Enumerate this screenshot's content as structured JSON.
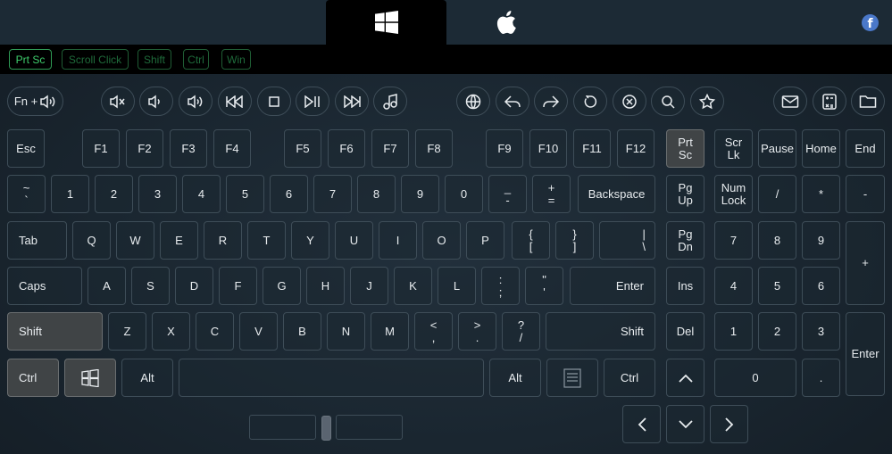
{
  "modifiers": [
    {
      "label": "Prt Sc",
      "active": true
    },
    {
      "label": "Scroll Click",
      "active": false
    },
    {
      "label": "Shift",
      "active": false
    },
    {
      "label": "Ctrl",
      "active": false
    },
    {
      "label": "Win",
      "active": false
    }
  ],
  "os_tabs": {
    "active": "windows",
    "icons": [
      "windows-logo-icon",
      "apple-logo-icon"
    ]
  },
  "header": {
    "social_icon": "facebook-icon",
    "fb_glyph": "f"
  },
  "media_keys": {
    "fn_vol": "Fn +"
  },
  "row_f": {
    "esc": "Esc",
    "f1": "F1",
    "f2": "F2",
    "f3": "F3",
    "f4": "F4",
    "f5": "F5",
    "f6": "F6",
    "f7": "F7",
    "f8": "F8",
    "f9": "F9",
    "f10": "F10",
    "f11": "F11",
    "f12": "F12",
    "prtsc": [
      "Prt",
      "Sc"
    ],
    "scrlk": [
      "Scr",
      "Lk"
    ],
    "pause": "Pause",
    "home": "Home",
    "end": "End"
  },
  "row_num": {
    "tilde": [
      "~",
      "`"
    ],
    "d1": "1",
    "d2": "2",
    "d3": "3",
    "d4": "4",
    "d5": "5",
    "d6": "6",
    "d7": "7",
    "d8": "8",
    "d9": "9",
    "d0": "0",
    "minus": [
      "_",
      "-"
    ],
    "equal": [
      "+",
      "="
    ],
    "backspace": "Backspace",
    "pgup": [
      "Pg",
      "Up"
    ],
    "numlock": [
      "Num",
      "Lock"
    ],
    "slash": "/",
    "star": "*",
    "dash": "-"
  },
  "row_q": {
    "tab": "Tab",
    "q": "Q",
    "w": "W",
    "e": "E",
    "r": "R",
    "t": "T",
    "y": "Y",
    "u": "U",
    "i": "I",
    "o": "O",
    "p": "P",
    "lbr": [
      "{",
      "["
    ],
    "rbr": [
      "}",
      "]"
    ],
    "pipe": [
      "|",
      "\\"
    ],
    "pgdn": [
      "Pg",
      "Dn"
    ],
    "n7": "7",
    "n8": "8",
    "n9": "9",
    "plus": "+"
  },
  "row_a": {
    "caps": "Caps",
    "a": "A",
    "s": "S",
    "d": "D",
    "f": "F",
    "g": "G",
    "h": "H",
    "j": "J",
    "k": "K",
    "l": "L",
    "semi": [
      ":",
      ";"
    ],
    "quote": [
      "\"",
      "'"
    ],
    "enter": "Enter",
    "ins": "Ins",
    "n4": "4",
    "n5": "5",
    "n6": "6"
  },
  "row_z": {
    "shift": "Shift",
    "z": "Z",
    "x": "X",
    "c": "C",
    "v": "V",
    "b": "B",
    "n": "N",
    "m": "M",
    "comma": [
      "<",
      ","
    ],
    "period": [
      ">",
      "."
    ],
    "question": [
      "?",
      "/"
    ],
    "rshift": "Shift",
    "del": "Del",
    "n1": "1",
    "n2": "2",
    "n3": "3",
    "numenter": "Enter"
  },
  "row_ctrl": {
    "ctrl": "Ctrl",
    "alt": "Alt",
    "ralt": "Alt",
    "rctrl": "Ctrl",
    "n0": "0",
    "ndot": "."
  }
}
